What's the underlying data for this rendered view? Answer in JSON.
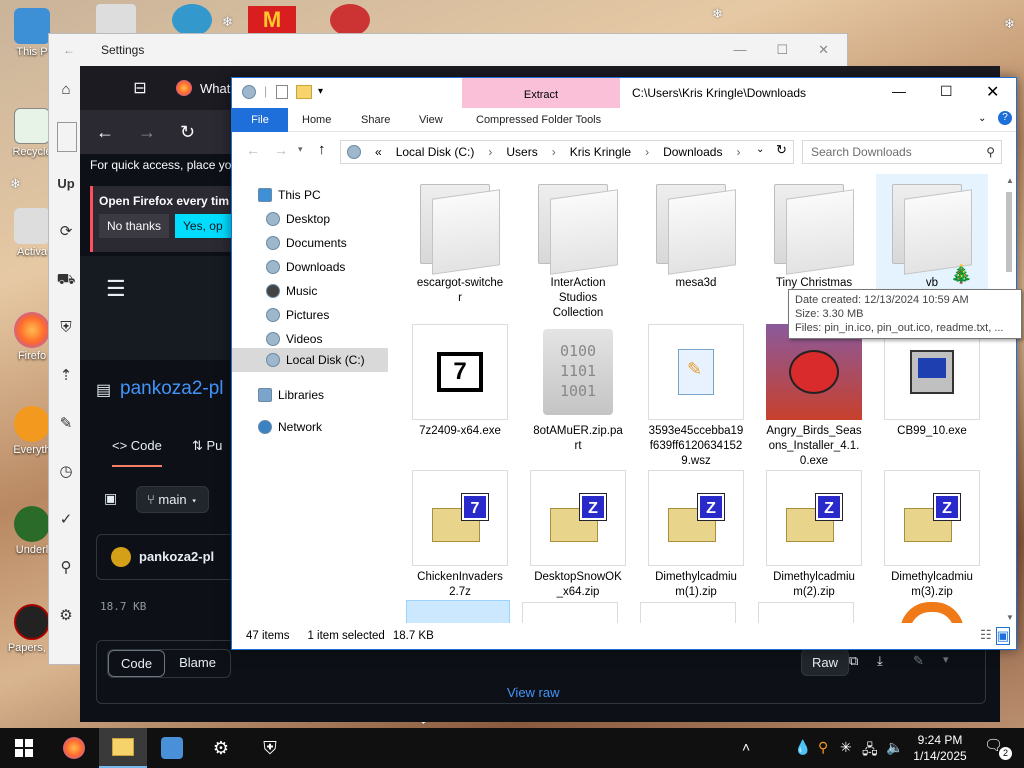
{
  "desktop": {
    "icons": [
      {
        "label": "This P"
      },
      {
        "label": "Recycle"
      },
      {
        "label": "Activa"
      },
      {
        "label": "Firefo"
      },
      {
        "label": "Everyth"
      },
      {
        "label": "Underl"
      },
      {
        "label": "Papers, P"
      }
    ]
  },
  "settings": {
    "title": "Settings",
    "nav_items": [
      "Up"
    ]
  },
  "firefox": {
    "tab_title": "What's",
    "quick_access": "For quick access, place yo",
    "notice_text": "Open Firefox every tim",
    "no_thanks": "No thanks",
    "yes_btn": "Yes, op",
    "repo": "pankoza2-pl",
    "code_tab": "Code",
    "pull_tab": "Pu",
    "branch": "main",
    "author": "pankoza2-pl",
    "file_size": "18.7 KB",
    "code_btn": "Code",
    "blame_btn": "Blame",
    "raw_btn": "Raw",
    "view_raw": "View raw"
  },
  "explorer": {
    "path_title": "C:\\Users\\Kris Kringle\\Downloads",
    "contextual_tab": "Extract",
    "ribbon_tabs": [
      "File",
      "Home",
      "Share",
      "View",
      "Compressed Folder Tools"
    ],
    "breadcrumb": [
      "«",
      "Local Disk (C:)",
      "Users",
      "Kris Kringle",
      "Downloads"
    ],
    "search_placeholder": "Search Downloads",
    "nav": {
      "this_pc": "This PC",
      "desktop": "Desktop",
      "documents": "Documents",
      "downloads": "Downloads",
      "music": "Music",
      "pictures": "Pictures",
      "videos": "Videos",
      "local_disk": "Local Disk (C:)",
      "libraries": "Libraries",
      "network": "Network"
    },
    "files": [
      {
        "name": "escargot-switche\nr",
        "kind": "folder"
      },
      {
        "name": "InterAction\nStudios\nCollection",
        "kind": "folder"
      },
      {
        "name": "mesa3d",
        "kind": "folder"
      },
      {
        "name": "Tiny Christmas",
        "kind": "folder"
      },
      {
        "name": "vb",
        "kind": "folder"
      },
      {
        "name": "7z2409-x64.exe",
        "kind": "exe"
      },
      {
        "name": "8otAMuER.zip.pa\nrt",
        "kind": "binary"
      },
      {
        "name": "3593e45ccebba19\nf639ff6120634152\n9.wsz",
        "kind": "wsz"
      },
      {
        "name": "Angry_Birds_Seas\nons_Installer_4.1.\n0.exe",
        "kind": "game"
      },
      {
        "name": "CB99_10.exe",
        "kind": "setup"
      },
      {
        "name": "ChickenInvaders\n2.7z",
        "kind": "7z"
      },
      {
        "name": "DesktopSnowOK\n_x64.zip",
        "kind": "zip"
      },
      {
        "name": "Dimethylcadmiu\nm(1).zip",
        "kind": "zip"
      },
      {
        "name": "Dimethylcadmiu\nm(2).zip",
        "kind": "zip"
      },
      {
        "name": "Dimethylcadmiu\nm(3).zip",
        "kind": "zip"
      }
    ],
    "tooltip": {
      "line1": "Date created: 12/13/2024 10:59 AM",
      "line2": "Size: 3.30 MB",
      "line3": "Files: pin_in.ico, pin_out.ico, readme.txt, ..."
    },
    "status": {
      "count": "47 items",
      "selected": "1 item selected",
      "size": "18.7 KB"
    }
  },
  "taskbar": {
    "time": "9:24 PM",
    "date": "1/14/2025",
    "notifications": "2"
  },
  "colors": {
    "explorer_accent": "#1e6fd9",
    "extract_tab": "#f9c0d8",
    "selection": "#cce8ff"
  }
}
